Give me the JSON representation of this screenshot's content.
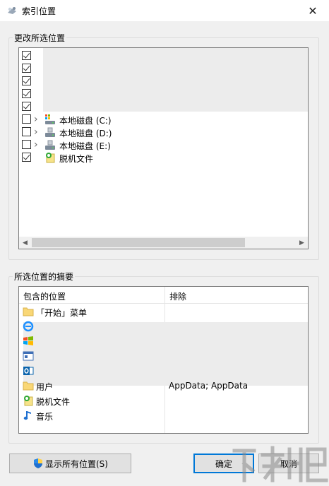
{
  "window": {
    "title": "索引位置",
    "icon": "indexing-options-icon",
    "close_symbol": "✕"
  },
  "change_locations": {
    "label": "更改所选位置",
    "rows": [
      {
        "checked": true,
        "expandable": false,
        "label": "",
        "icon": ""
      },
      {
        "checked": true,
        "expandable": false,
        "label": "",
        "icon": ""
      },
      {
        "checked": true,
        "expandable": false,
        "label": "",
        "icon": ""
      },
      {
        "checked": true,
        "expandable": false,
        "label": "",
        "icon": ""
      },
      {
        "checked": true,
        "expandable": false,
        "label": "",
        "icon": ""
      },
      {
        "checked": false,
        "expandable": true,
        "label": "本地磁盘 (C:)",
        "icon": "system-drive-icon"
      },
      {
        "checked": false,
        "expandable": true,
        "label": "本地磁盘 (D:)",
        "icon": "drive-icon"
      },
      {
        "checked": false,
        "expandable": true,
        "label": "本地磁盘 (E:)",
        "icon": "drive-icon"
      },
      {
        "checked": true,
        "expandable": false,
        "label": "脱机文件",
        "icon": "offline-files-icon"
      }
    ]
  },
  "summary": {
    "label": "所选位置的摘要",
    "col_included": "包含的位置",
    "col_excluded": "排除",
    "rows": [
      {
        "icon": "folder-icon",
        "label": "「开始」菜单",
        "excluded": ""
      },
      {
        "icon": "internet-explorer-icon",
        "label": "",
        "excluded": ""
      },
      {
        "icon": "windows-flag-icon",
        "label": "",
        "excluded": ""
      },
      {
        "icon": "window-app-icon",
        "label": "",
        "excluded": ""
      },
      {
        "icon": "outlook-icon",
        "label": "",
        "excluded": ""
      },
      {
        "icon": "folder-icon",
        "label": "用户",
        "excluded": "AppData; AppData"
      },
      {
        "icon": "offline-files-icon",
        "label": "脱机文件",
        "excluded": ""
      },
      {
        "icon": "music-icon",
        "label": "音乐",
        "excluded": ""
      }
    ]
  },
  "buttons": {
    "show_all": "显示所有位置(S)",
    "ok": "确定",
    "cancel": "取消"
  },
  "colors": {
    "accent": "#0078d7",
    "panel_border": "#7a7a7a",
    "gray_fill": "#ececec"
  }
}
